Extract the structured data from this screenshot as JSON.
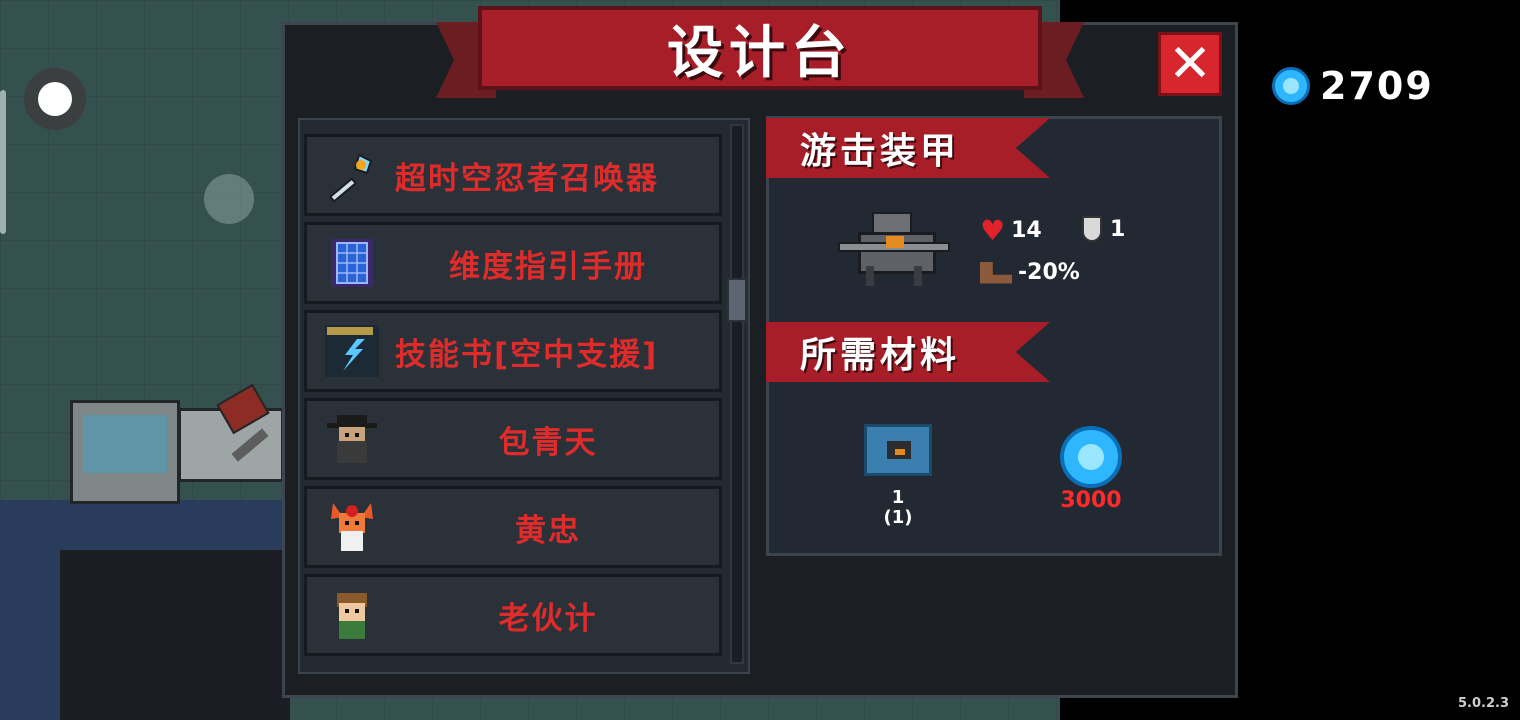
{
  "title": "设计台",
  "close_label": "✕",
  "currency": {
    "icon": "gem-icon",
    "amount": "2709"
  },
  "recipes": [
    {
      "icon": "wand-icon",
      "name": "超时空忍者召唤器"
    },
    {
      "icon": "grid-book-icon",
      "name": "维度指引手册"
    },
    {
      "icon": "lightning-book-icon",
      "name": "技能书[空中支援]"
    },
    {
      "icon": "bearded-hero-icon",
      "name": "包青天"
    },
    {
      "icon": "fox-warrior-icon",
      "name": "黄忠"
    },
    {
      "icon": "brown-hair-hero-icon",
      "name": "老伙计"
    }
  ],
  "selected": {
    "name": "游击装甲",
    "icon": "mech-armor-icon",
    "stats": {
      "health": "14",
      "armor": "1",
      "speed": "-20%"
    }
  },
  "materials_heading": "所需材料",
  "materials": [
    {
      "icon": "mech-blueprint-icon",
      "count": "1",
      "sub": "(1)"
    },
    {
      "icon": "gem-icon",
      "count": "3000"
    }
  ],
  "version": "5.0.2.3",
  "colors": {
    "accent_red": "#a81e28",
    "text_red": "#e02b2b",
    "gem_blue": "#2eb7ff"
  }
}
